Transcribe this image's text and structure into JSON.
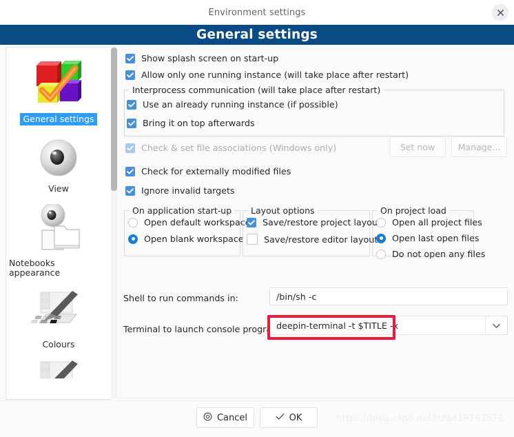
{
  "window": {
    "title": "Environment settings",
    "close_icon": "close-icon"
  },
  "header": {
    "title": "General settings"
  },
  "sidebar": {
    "items": [
      {
        "label": "General settings",
        "icon": "colored-cubes-check-icon",
        "selected": true
      },
      {
        "label": "View",
        "icon": "eye-icon",
        "selected": false
      },
      {
        "label": "Notebooks appearance",
        "icon": "folders-eye-icon",
        "selected": false
      },
      {
        "label": "Colours",
        "icon": "palette-brush-icon",
        "selected": false
      },
      {
        "label": "",
        "icon": "palette-brush-icon",
        "selected": false
      }
    ]
  },
  "main": {
    "checkboxes": [
      {
        "label": "Show splash screen on start-up",
        "checked": true,
        "disabled": false
      },
      {
        "label": "Allow only one running instance (will take place after restart)",
        "checked": true,
        "disabled": false
      }
    ],
    "interprocess": {
      "title": "Interprocess communication (will take place after restart)",
      "items": [
        {
          "label": "Use an already running instance (if possible)",
          "checked": true
        },
        {
          "label": "Bring it on top afterwards",
          "checked": true
        }
      ]
    },
    "file_assoc": {
      "label": "Check & set file associations (Windows only)",
      "checked": true,
      "disabled": true,
      "set_now_label": "Set now",
      "manage_label": "Manage..."
    },
    "checkboxes2": [
      {
        "label": "Check for externally modified files",
        "checked": true
      },
      {
        "label": "Ignore invalid targets",
        "checked": true
      }
    ],
    "startup_group": {
      "title": "On application start-up",
      "options": [
        {
          "label": "Open default workspace",
          "selected": false
        },
        {
          "label": "Open blank workspace",
          "selected": true
        }
      ]
    },
    "layout_group": {
      "title": "Layout options",
      "options": [
        {
          "label": "Save/restore project layout",
          "checked": true
        },
        {
          "label": "Save/restore editor layout",
          "checked": false
        }
      ]
    },
    "projectload_group": {
      "title": "On project load",
      "options": [
        {
          "label": "Open all project files",
          "selected": false
        },
        {
          "label": "Open last open files",
          "selected": true
        },
        {
          "label": "Do not open any files",
          "selected": false
        }
      ]
    },
    "shell": {
      "label": "Shell to run commands in:",
      "value": "/bin/sh -c",
      "placeholder": ""
    },
    "terminal": {
      "label": "Terminal to launch console programs",
      "value": "deepin-terminal -t $TITLE -x",
      "placeholder": "",
      "dropdown_icon": "chevron-down-icon",
      "highlight_color": "#ec1a3c"
    }
  },
  "footer": {
    "cancel_label": "Cancel",
    "cancel_icon": "cancel-circle-icon",
    "ok_label": "OK",
    "ok_icon": "check-icon"
  },
  "watermark": {
    "text": "https://blog.csdn.net/hza419763578"
  },
  "colors": {
    "header_blue": "#0b4b85",
    "checkbox_blue": "#4a90d9",
    "radio_blue": "#1a7fd4",
    "selection_blue": "#2e9ef4",
    "highlight_red": "#ec1a3c"
  }
}
